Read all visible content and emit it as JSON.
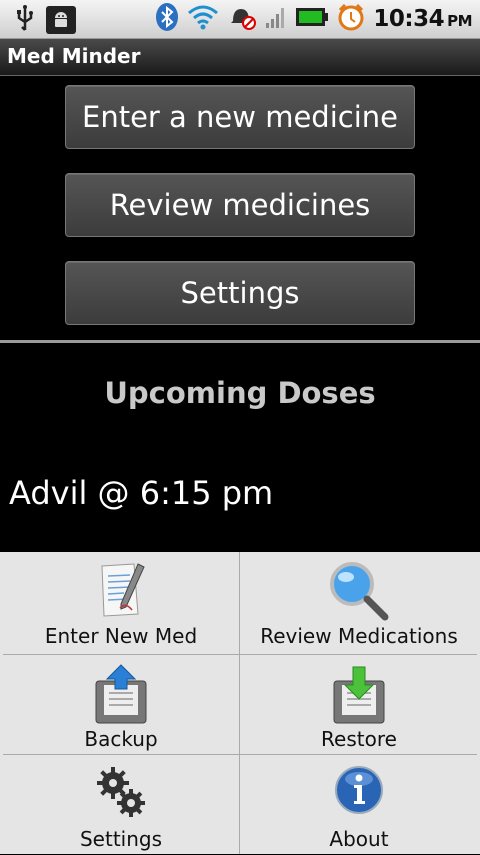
{
  "status": {
    "time": "10:34",
    "ampm": "PM"
  },
  "app": {
    "title": "Med Minder"
  },
  "buttons": {
    "new_medicine": "Enter a new medicine",
    "review": "Review medicines",
    "settings": "Settings"
  },
  "upcoming": {
    "heading": "Upcoming Doses",
    "items": [
      "Advil @ 6:15 pm"
    ]
  },
  "menu": {
    "enter_new_med": "Enter New Med",
    "review_medications": "Review Medications",
    "backup": "Backup",
    "restore": "Restore",
    "settings": "Settings",
    "about": "About"
  },
  "colors": {
    "battery": "#22bb22",
    "alarm": "#e07818",
    "menu_bg": "#e5e5e5"
  }
}
